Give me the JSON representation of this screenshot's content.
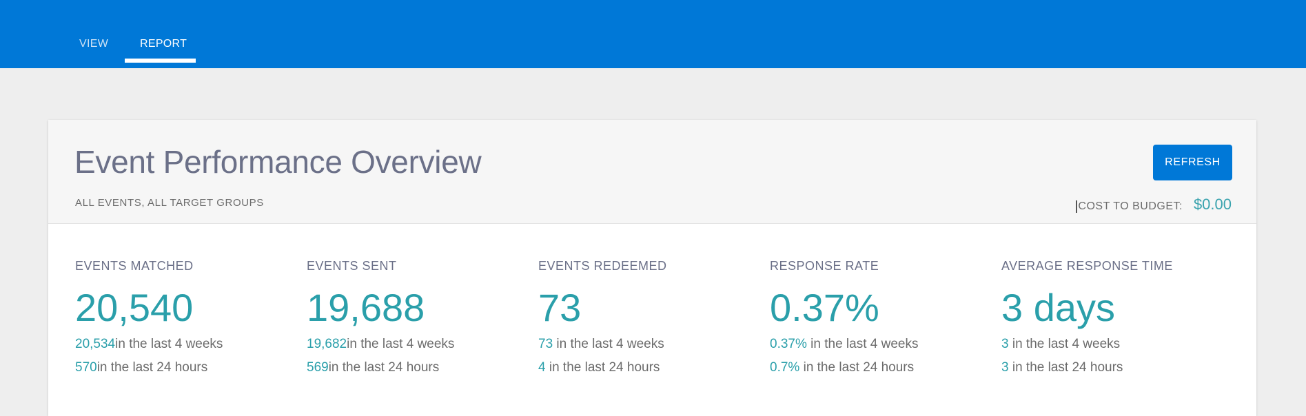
{
  "nav": {
    "tabs": [
      {
        "label": "VIEW"
      },
      {
        "label": "REPORT",
        "active": true
      }
    ]
  },
  "card": {
    "title": "Event Performance Overview",
    "subtitle": "ALL EVENTS, ALL TARGET GROUPS",
    "refresh_label": "REFRESH",
    "cost_label": "COST TO BUDGET:",
    "cost_value": "$0.00"
  },
  "stats": [
    {
      "label": "EVENTS MATCHED",
      "value": "20,540",
      "weeks_value": "20,534",
      "weeks_text": "in the last 4 weeks",
      "hours_value": "570",
      "hours_text": "in the last 24 hours"
    },
    {
      "label": "EVENTS SENT",
      "value": "19,688",
      "weeks_value": "19,682",
      "weeks_text": "in the last 4 weeks",
      "hours_value": "569",
      "hours_text": "in the last 24 hours"
    },
    {
      "label": "EVENTS REDEEMED",
      "value": "73",
      "weeks_value": "73",
      "weeks_text": " in the last 4 weeks",
      "hours_value": "4",
      "hours_text": " in the last 24 hours"
    },
    {
      "label": "RESPONSE RATE",
      "value": "0.37%",
      "weeks_value": "0.37%",
      "weeks_text": " in the last 4 weeks",
      "hours_value": "0.7%",
      "hours_text": " in the last 24 hours"
    },
    {
      "label": "AVERAGE RESPONSE TIME",
      "value": "3 days",
      "weeks_value": "3",
      "weeks_text": " in the last 4 weeks",
      "hours_value": "3",
      "hours_text": " in the last 24 hours"
    }
  ],
  "colors": {
    "brand": "#0078d7",
    "accent": "#2a9faa"
  }
}
